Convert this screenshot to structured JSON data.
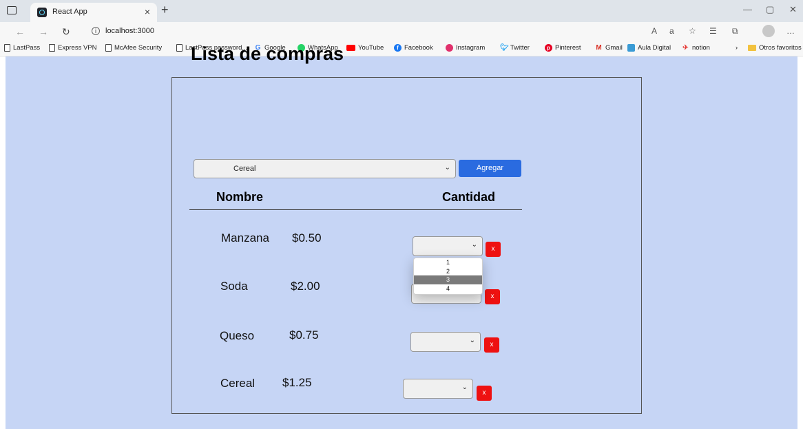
{
  "browser": {
    "tab_title": "React App",
    "tab_close": "×",
    "new_tab": "+",
    "url": "localhost:3000",
    "window_controls": {
      "minimize": "—",
      "restore": "▢",
      "close": "✕"
    },
    "bookmarks": [
      {
        "label": "LastPass",
        "icon": "page-icon"
      },
      {
        "label": "Express VPN",
        "icon": "page-icon"
      },
      {
        "label": "McAfee Security",
        "icon": "page-icon"
      },
      {
        "label": "LastPass password...",
        "icon": "page-icon"
      },
      {
        "label": "Google",
        "icon": "google-icon",
        "color": "#4285f4"
      },
      {
        "label": "WhatsApp",
        "icon": "whatsapp-icon",
        "color": "#25d366"
      },
      {
        "label": "YouTube",
        "icon": "youtube-icon",
        "color": "#ff0000"
      },
      {
        "label": "Facebook",
        "icon": "facebook-icon",
        "color": "#1877f2"
      },
      {
        "label": "Instagram",
        "icon": "instagram-icon",
        "color": "#e1306c"
      },
      {
        "label": "Twitter",
        "icon": "twitter-icon",
        "color": "#1da1f2"
      },
      {
        "label": "Pinterest",
        "icon": "pinterest-icon",
        "color": "#e60023"
      },
      {
        "label": "Gmail",
        "icon": "gmail-icon",
        "color": "#d93025"
      },
      {
        "label": "Aula Digital",
        "icon": "aula-digital-icon",
        "color": "#3a9bd5"
      },
      {
        "label": "notion",
        "icon": "pin-icon",
        "color": "#e53935"
      }
    ],
    "other_favorites": "Otros favoritos"
  },
  "app": {
    "title": "Lista de compras",
    "product_select": {
      "selected": "Cereal"
    },
    "add_button": "Agregar",
    "columns": {
      "name": "Nombre",
      "quantity": "Cantidad"
    },
    "items": [
      {
        "name": "Manzana",
        "price": "$0.50"
      },
      {
        "name": "Soda",
        "price": "$2.00"
      },
      {
        "name": "Queso",
        "price": "$0.75"
      },
      {
        "name": "Cereal",
        "price": "$1.25"
      }
    ],
    "delete_label": "x",
    "open_dropdown_options": [
      "1",
      "2",
      "3",
      "4"
    ],
    "highlighted_option": "3"
  },
  "colors": {
    "page_background": "#c6d5f5",
    "add_button": "#2a6be0",
    "delete_button": "#ee1111"
  }
}
